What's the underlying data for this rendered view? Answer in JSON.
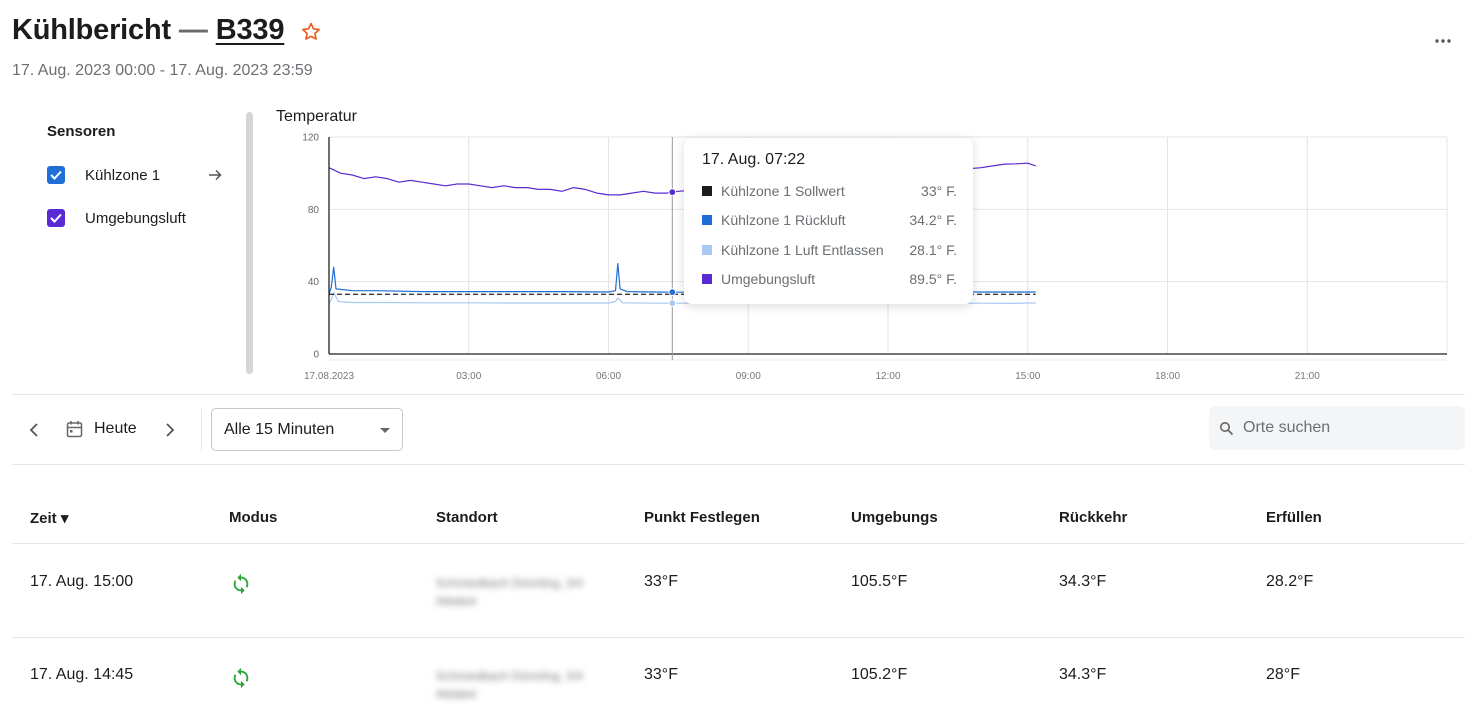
{
  "header": {
    "title": "Kühlbericht",
    "separator": "—",
    "asset": "B339",
    "date_range": "17. Aug. 2023 00:00 - 17. Aug. 2023 23:59"
  },
  "icons": {
    "favorite": "star-outline-icon",
    "more": "more-horizontal-icon",
    "calendar": "calendar-icon",
    "search": "search-icon",
    "mode": "sync-icon",
    "expand": "arrow-right-icon"
  },
  "colors": {
    "accent_orange": "#e8591a",
    "zone_blue": "#1f6fd6",
    "ambient_purple": "#5a2bd2",
    "return_light_blue": "#a9c8f2",
    "mode_green": "#2aa53a",
    "setpoint_dash": "#3a3a3a"
  },
  "sensors": {
    "title": "Sensoren",
    "items": [
      {
        "label": "Kühlzone 1",
        "checked": true,
        "color": "#1f6fd6"
      },
      {
        "label": "Umgebungsluft",
        "checked": true,
        "color": "#5a2bd2"
      }
    ]
  },
  "chart_data": {
    "type": "line",
    "title": "Temperatur",
    "x_unit": "hours on 17.08.2023",
    "xlim": [
      0,
      24
    ],
    "ylim": [
      0,
      120
    ],
    "y_ticks": [
      "0",
      "40",
      "80",
      "120"
    ],
    "x_ticks": [
      "17.08.2023",
      "03:00",
      "06:00",
      "09:00",
      "12:00",
      "15:00",
      "18:00",
      "21:00"
    ],
    "grid": true,
    "crosshair_x": 7.37,
    "series": [
      {
        "name": "Umgebungsluft",
        "color": "#5a2bd2",
        "x": [
          0,
          0.25,
          0.5,
          0.75,
          1.0,
          1.25,
          1.5,
          1.75,
          2.0,
          2.25,
          2.5,
          2.75,
          3.0,
          3.25,
          3.5,
          3.75,
          4.0,
          4.25,
          4.5,
          4.75,
          5.0,
          5.25,
          5.5,
          5.75,
          6.0,
          6.25,
          6.5,
          6.75,
          7.0,
          7.25,
          7.37,
          7.5,
          8.0,
          9.0,
          10.0,
          11.0,
          11.5,
          12.0,
          12.5,
          13.0,
          13.5,
          14.0,
          14.25,
          14.5,
          14.75,
          15.0,
          15.17
        ],
        "values": [
          103,
          100,
          99,
          97,
          98,
          97,
          95,
          96,
          95,
          94,
          93,
          94,
          94,
          93,
          92,
          93,
          92,
          92,
          91,
          91,
          90,
          92,
          91,
          89,
          88,
          88,
          89,
          90,
          89,
          89,
          89.5,
          90,
          91,
          93,
          95,
          97,
          98,
          99,
          100,
          101,
          102,
          103,
          104,
          105,
          105.2,
          105.5,
          104
        ]
      },
      {
        "name": "Kühlzone 1 Rückluft",
        "color": "#1f6fd6",
        "x": [
          0,
          0.05,
          0.1,
          0.15,
          0.5,
          1.0,
          2.0,
          3.0,
          4.0,
          5.0,
          6.0,
          6.15,
          6.2,
          6.25,
          6.4,
          7.0,
          7.37,
          8.0,
          9.0,
          10.0,
          11.0,
          12.0,
          13.0,
          14.0,
          14.75,
          15.0,
          15.17
        ],
        "values": [
          33,
          37,
          48,
          36,
          35,
          35,
          34.5,
          34.5,
          34.5,
          34.5,
          34.3,
          35,
          50,
          36,
          34.5,
          34.3,
          34.2,
          34.2,
          34.2,
          34.3,
          34.3,
          34.3,
          34.3,
          34.3,
          34.3,
          34.3,
          34.3
        ]
      },
      {
        "name": "Kühlzone 1 Luft Entlassen",
        "color": "#a9c8f2",
        "x": [
          0,
          0.05,
          0.1,
          0.2,
          0.5,
          1.0,
          2.0,
          3.0,
          4.0,
          5.0,
          6.0,
          6.15,
          6.2,
          6.3,
          7.0,
          7.37,
          8.0,
          10.0,
          12.0,
          14.0,
          14.75,
          15.0,
          15.17
        ],
        "values": [
          28,
          30,
          34,
          29,
          28.5,
          28.5,
          28.3,
          28.3,
          28.2,
          28.2,
          28.2,
          29,
          31,
          28.3,
          28.1,
          28.1,
          28.1,
          28.1,
          28.1,
          28.1,
          28,
          28.2,
          28.2
        ]
      },
      {
        "name": "Kühlzone 1 Sollwert",
        "color": "#3a3a3a",
        "dashed": true,
        "x": [
          0,
          15.17
        ],
        "values": [
          33,
          33
        ]
      }
    ]
  },
  "tooltip": {
    "time": "17. Aug. 07:22",
    "rows": [
      {
        "label": "Kühlzone 1 Sollwert",
        "value": "33° F.",
        "color": "#1c1c1c"
      },
      {
        "label": "Kühlzone 1 Rückluft",
        "value": "34.2° F.",
        "color": "#1f6fd6"
      },
      {
        "label": "Kühlzone 1 Luft Entlassen",
        "value": "28.1° F.",
        "color": "#a9c8f2"
      },
      {
        "label": "Umgebungsluft",
        "value": "89.5° F.",
        "color": "#5a2bd2"
      }
    ]
  },
  "toolbar": {
    "today_label": "Heute",
    "interval": "Alle 15 Minuten",
    "search_placeholder": "Orte suchen",
    "search_value": ""
  },
  "table": {
    "columns": [
      "Zeit ▾",
      "Modus",
      "Standort",
      "Punkt Festlegen",
      "Umgebungs",
      "Rückkehr",
      "Erfüllen"
    ],
    "rows": [
      {
        "time": "17. Aug. 15:00",
        "location_line1": "Schmiedbach Dünnling, 3/4",
        "location_line2": "Ablabel",
        "setpoint": "33°F",
        "ambient": "105.5°F",
        "return": "34.3°F",
        "supply": "28.2°F"
      },
      {
        "time": "17. Aug. 14:45",
        "location_line1": "Schmiedbach Dünnling, 3/4",
        "location_line2": "Ablabel",
        "setpoint": "33°F",
        "ambient": "105.2°F",
        "return": "34.3°F",
        "supply": "28°F"
      }
    ]
  }
}
